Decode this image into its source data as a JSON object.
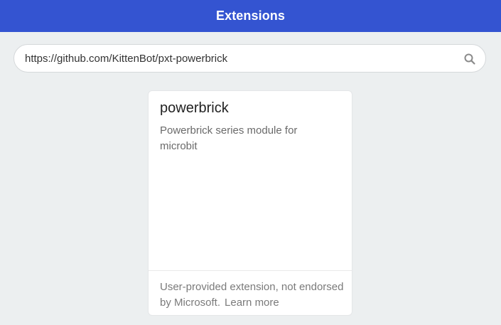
{
  "header": {
    "title": "Extensions"
  },
  "search": {
    "value": "https://github.com/KittenBot/pxt-powerbrick",
    "icon": "search-icon"
  },
  "card": {
    "title": "powerbrick",
    "description": "Powerbrick series module for microbit",
    "footer_text": "User-provided extension, not endorsed by Microsoft.",
    "learn_more": "Learn more"
  },
  "colors": {
    "header_bg": "#3454d1",
    "page_bg": "#eceff0"
  }
}
